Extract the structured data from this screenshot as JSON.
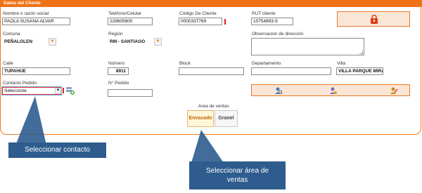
{
  "panel": {
    "title": "Datos del Cliente"
  },
  "fields": {
    "nombre": {
      "label": "Nombre o razón social",
      "value": "PAOLA SUSANA ALVAR"
    },
    "telefono": {
      "label": "Teléfono/Celular",
      "value": "229805800"
    },
    "codigo": {
      "label": "Código De Cliente",
      "value": "0000337769"
    },
    "rut": {
      "label": "RUT cliente",
      "value": "10754893-9"
    },
    "comuna": {
      "label": "Comuna",
      "value": "PEÑALOLEN"
    },
    "region": {
      "label": "Región",
      "value": "RM - SANTIAGO"
    },
    "observacion": {
      "label": "Observación de dirección",
      "value": ""
    },
    "calle": {
      "label": "Calle",
      "value": "TUPAHUE"
    },
    "numero": {
      "label": "Número",
      "value": "8911"
    },
    "block": {
      "label": "Block",
      "value": ""
    },
    "departamento": {
      "label": "Departamento",
      "value": ""
    },
    "villa": {
      "label": "Villa",
      "value": "VILLA PARQUE MIRADO"
    },
    "contacto": {
      "label": "Contacto Pedido",
      "value": "Seleccione"
    },
    "npedido": {
      "label": "N° Pedido",
      "value": ""
    }
  },
  "area_ventas": {
    "label": "Area de ventas",
    "options": [
      "Envasado",
      "Granel"
    ],
    "selected": "Envasado"
  },
  "icons": {
    "lock": "lock-icon",
    "contact_add": "add-contact-icon",
    "search_user": "search-user-icon",
    "user_settings": "user-settings-icon",
    "user_edit": "user-edit-icon"
  },
  "callouts": {
    "contacto": "Seleccionar contacto",
    "area": "Seleccionar área de ventas"
  },
  "colors": {
    "accent": "#ef7316",
    "callout": "#2e5c8e",
    "required": "#e02020"
  }
}
